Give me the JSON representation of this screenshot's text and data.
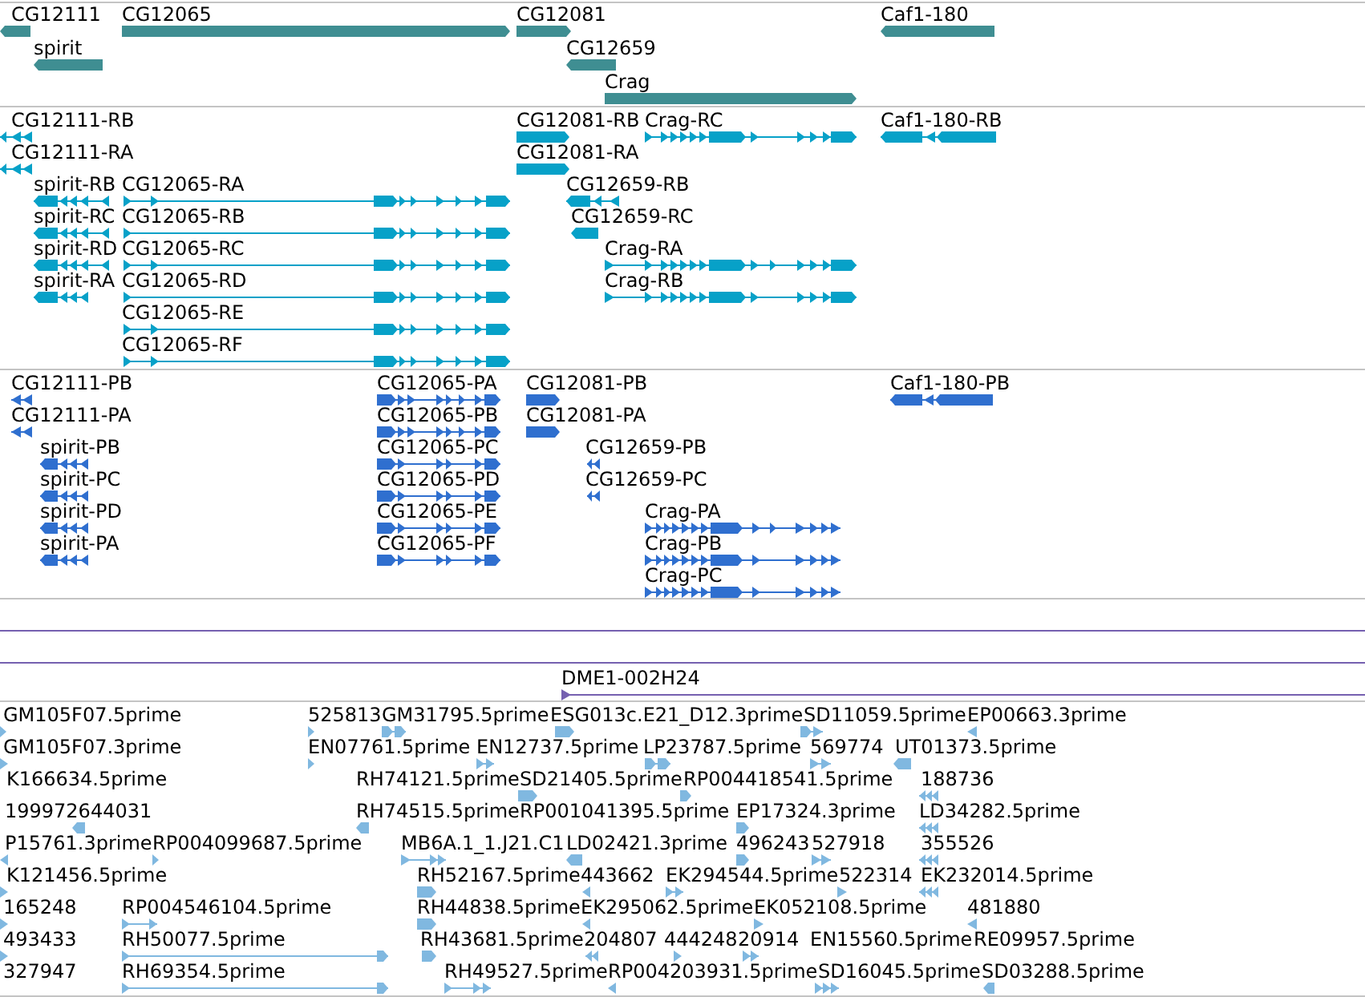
{
  "tracks": [
    {
      "kind": "gene",
      "features": [
        {
          "label": "CG12111",
          "reverse": true
        },
        {
          "label": "CG12065",
          "reverse": false
        },
        {
          "label": "CG12081",
          "reverse": false
        },
        {
          "label": "Caf1-180",
          "reverse": true
        },
        {
          "label": "spirit",
          "reverse": true
        },
        {
          "label": "CG12659",
          "reverse": true
        },
        {
          "label": "Crag",
          "reverse": false
        }
      ]
    },
    {
      "kind": "transcript",
      "features": [
        {
          "label": "CG12111-RB",
          "reverse": true
        },
        {
          "label": "CG12081-RB",
          "reverse": false
        },
        {
          "label": "Crag-RC",
          "reverse": false
        },
        {
          "label": "Caf1-180-RB",
          "reverse": true
        },
        {
          "label": "CG12111-RA",
          "reverse": true
        },
        {
          "label": "CG12081-RA",
          "reverse": false
        },
        {
          "label": "spirit-RB",
          "reverse": true
        },
        {
          "label": "CG12065-RA",
          "reverse": false
        },
        {
          "label": "CG12659-RB",
          "reverse": true
        },
        {
          "label": "spirit-RC",
          "reverse": true
        },
        {
          "label": "CG12065-RB",
          "reverse": false
        },
        {
          "label": "CG12659-RC",
          "reverse": true
        },
        {
          "label": "spirit-RD",
          "reverse": true
        },
        {
          "label": "CG12065-RC",
          "reverse": false
        },
        {
          "label": "Crag-RA",
          "reverse": false
        },
        {
          "label": "spirit-RA",
          "reverse": true
        },
        {
          "label": "CG12065-RD",
          "reverse": false
        },
        {
          "label": "Crag-RB",
          "reverse": false
        },
        {
          "label": "CG12065-RE",
          "reverse": false
        },
        {
          "label": "CG12065-RF",
          "reverse": false
        }
      ]
    },
    {
      "kind": "protein",
      "features": [
        {
          "label": "CG12111-PB",
          "reverse": true
        },
        {
          "label": "CG12065-PA",
          "reverse": false
        },
        {
          "label": "CG12081-PB",
          "reverse": false
        },
        {
          "label": "Caf1-180-PB",
          "reverse": true
        },
        {
          "label": "CG12111-PA",
          "reverse": true
        },
        {
          "label": "CG12065-PB",
          "reverse": false
        },
        {
          "label": "CG12081-PA",
          "reverse": false
        },
        {
          "label": "spirit-PB",
          "reverse": true
        },
        {
          "label": "CG12065-PC",
          "reverse": false
        },
        {
          "label": "CG12659-PB",
          "reverse": true
        },
        {
          "label": "spirit-PC",
          "reverse": true
        },
        {
          "label": "CG12065-PD",
          "reverse": false
        },
        {
          "label": "CG12659-PC",
          "reverse": true
        },
        {
          "label": "spirit-PD",
          "reverse": true
        },
        {
          "label": "CG12065-PE",
          "reverse": false
        },
        {
          "label": "Crag-PA",
          "reverse": false
        },
        {
          "label": "spirit-PA",
          "reverse": true
        },
        {
          "label": "CG12065-PF",
          "reverse": false
        },
        {
          "label": "Crag-PB",
          "reverse": false
        },
        {
          "label": "Crag-PC",
          "reverse": false
        }
      ]
    },
    {
      "kind": "clone",
      "features": [
        {
          "kind": "span"
        },
        {
          "kind": "span"
        },
        {
          "kind": "start",
          "label": "DME1-002H24",
          "reverse": false
        }
      ]
    },
    {
      "kind": "est",
      "features": [
        {
          "label": "GM105F07.5prime",
          "reverse": false
        },
        {
          "label": "525813",
          "reverse": false
        },
        {
          "label": "GM31795.5prime",
          "reverse": false
        },
        {
          "label": "ESG013c.E21_D12.3prime",
          "reverse": false
        },
        {
          "label": "SD11059.5prime",
          "reverse": false
        },
        {
          "label": "EP00663.3prime",
          "reverse": true
        },
        {
          "label": "GM105F07.3prime",
          "reverse": false
        },
        {
          "label": "EN07761.5prime",
          "reverse": false
        },
        {
          "label": "EN12737.5prime",
          "reverse": false
        },
        {
          "label": "LP23787.5prime",
          "reverse": false
        },
        {
          "label": "569774",
          "reverse": false
        },
        {
          "label": "UT01373.5prime",
          "reverse": true
        },
        {
          "label": "K166634.5prime"
        },
        {
          "label": "RH74121.5prime"
        },
        {
          "label": "SD21405.5prime",
          "reverse": false
        },
        {
          "label": "RP004418541.5prime",
          "reverse": false
        },
        {
          "label": "188736",
          "reverse": true
        },
        {
          "label": "199972644031",
          "reverse": true
        },
        {
          "label": "RH74515.5prime",
          "reverse": true
        },
        {
          "label": "RP001041395.5prime"
        },
        {
          "label": "EP17324.3prime",
          "reverse": false
        },
        {
          "label": "LD34282.5prime",
          "reverse": true
        },
        {
          "label": "P15761.3prime",
          "reverse": true
        },
        {
          "label": "RP004099687.5prime",
          "reverse": false
        },
        {
          "label": "MB6A.1_1.J21.C1",
          "reverse": false
        },
        {
          "label": "LD02421.3prime",
          "reverse": true
        },
        {
          "label": "496243",
          "reverse": false
        },
        {
          "label": "527918",
          "reverse": false
        },
        {
          "label": "355526",
          "reverse": true
        },
        {
          "label": "K121456.5prime",
          "reverse": false
        },
        {
          "label": "RH52167.5prime",
          "reverse": false
        },
        {
          "label": "443662",
          "reverse": true
        },
        {
          "label": "EK294544.5prime",
          "reverse": false
        },
        {
          "label": "522314",
          "reverse": false
        },
        {
          "label": "EK232014.5prime",
          "reverse": true
        },
        {
          "label": "165248",
          "reverse": false
        },
        {
          "label": "RP004546104.5prime",
          "reverse": false
        },
        {
          "label": "RH44838.5prime",
          "reverse": false
        },
        {
          "label": "EK295062.5prime",
          "reverse": true
        },
        {
          "label": "EK052108.5prime",
          "reverse": false
        },
        {
          "label": "481880",
          "reverse": true
        },
        {
          "label": "493433",
          "reverse": false
        },
        {
          "label": "RH50077.5prime",
          "reverse": false
        },
        {
          "label": "RH43681.5prime",
          "reverse": false
        },
        {
          "label": "204807",
          "reverse": true
        },
        {
          "label": "444248",
          "reverse": false
        },
        {
          "label": "20914",
          "reverse": false
        },
        {
          "label": "EN15560.5prime"
        },
        {
          "label": "RE09957.5prime"
        },
        {
          "label": "327947"
        },
        {
          "label": "RH69354.5prime",
          "reverse": false
        },
        {
          "label": "RH49527.5prime",
          "reverse": false
        },
        {
          "label": "RP004203931.5prime",
          "reverse": true
        },
        {
          "label": "SD16045.5prime",
          "reverse": false
        },
        {
          "label": "SD03288.5prime",
          "reverse": true
        }
      ]
    }
  ]
}
